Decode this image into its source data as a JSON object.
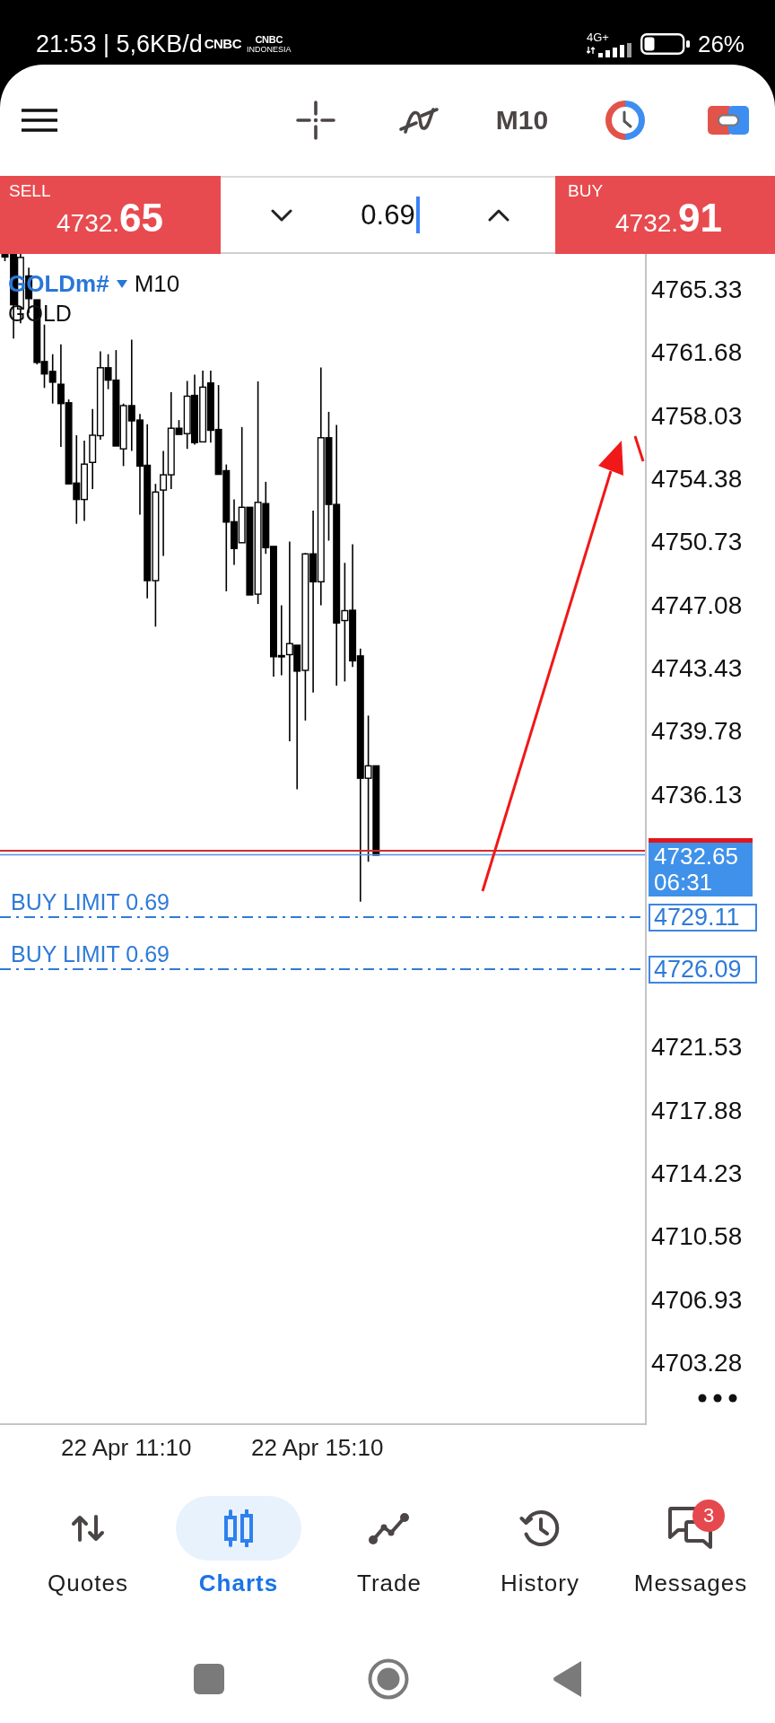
{
  "status_bar": {
    "time_and_speed": "21:53 | 5,6KB/d",
    "notification_logos": [
      {
        "name": "CNBC"
      },
      {
        "name": "CNBC",
        "subtitle": "INDONESIA"
      }
    ],
    "network": "4G+",
    "battery": "26%"
  },
  "toolbar": {
    "timeframe": "M10"
  },
  "trade_panel": {
    "sell": {
      "label": "SELL",
      "price": "4732.**65**"
    },
    "volume": {
      "value": "0.69",
      "focused": true
    },
    "buy": {
      "label": "BUY",
      "price": "4732.**91**"
    }
  },
  "chart": {
    "symbol": "GOLDm#",
    "timeframe": "M10",
    "description": "GOLD",
    "price_scale": {
      "upper": [
        "4765.33",
        "4761.68",
        "4758.03",
        "4754.38",
        "4750.73",
        "4747.08",
        "4743.43",
        "4739.78",
        "4736.13"
      ],
      "lower": [
        "4721.53",
        "4717.88",
        "4714.23",
        "4710.58",
        "4706.93",
        "4703.28"
      ]
    },
    "current_price": {
      "price": "4732.65",
      "countdown": "06:31"
    },
    "orders": [
      {
        "label": "BUY LIMIT 0.69",
        "price": "4729.11"
      },
      {
        "label": "BUY LIMIT 0.69",
        "price": "4726.09"
      }
    ],
    "time_scale": [
      "22 Apr 11:10",
      "22 Apr 15:10"
    ]
  },
  "bottom_nav": [
    {
      "label": "Quotes",
      "selected": false
    },
    {
      "label": "Charts",
      "selected": true
    },
    {
      "label": "Trade",
      "selected": false
    },
    {
      "label": "History",
      "selected": false
    },
    {
      "label": "Messages",
      "selected": false,
      "badge": "3"
    }
  ]
}
